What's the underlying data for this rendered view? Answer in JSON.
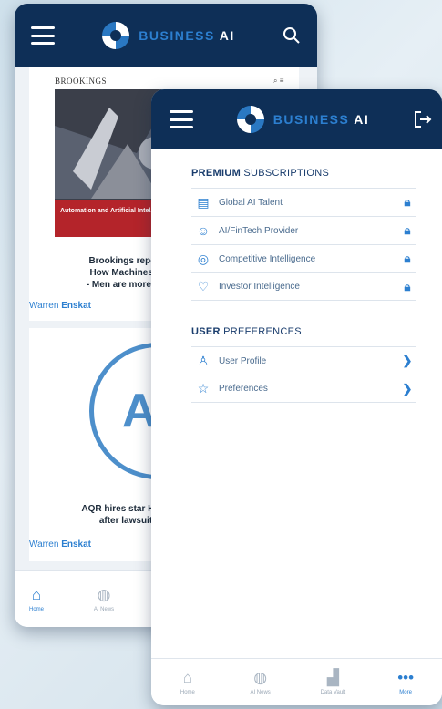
{
  "brand": {
    "part1": "BUSINESS",
    "part2": "AI"
  },
  "back_screen": {
    "article1": {
      "source": "BROOKINGS",
      "image_caption": "Automation and Artificial Intel...",
      "headline_lines": [
        "Brookings report",
        "How Machines A",
        "- Men are more Vu"
      ],
      "author_first": "Warren",
      "author_last": "Enskat"
    },
    "article2": {
      "logo_text": "AQ",
      "headline_lines": [
        "AQR hires star Head",
        "after lawsuit"
      ],
      "author_first": "Warren",
      "author_last": "Enskat"
    },
    "tabs": [
      {
        "label": "Home",
        "icon": "home-icon"
      },
      {
        "label": "AI News",
        "icon": "globe-icon"
      }
    ]
  },
  "menu": {
    "premium": {
      "title_bold": "PREMIUM",
      "title_rest": " SUBSCRIPTIONS",
      "items": [
        {
          "label": "Global AI Talent",
          "icon": "talent-icon"
        },
        {
          "label": "AI/FinTech Provider",
          "icon": "provider-icon"
        },
        {
          "label": "Competitive Intelligence",
          "icon": "target-icon"
        },
        {
          "label": "Investor Intelligence",
          "icon": "handshake-icon"
        }
      ]
    },
    "prefs": {
      "title_bold": "USER",
      "title_rest": " PREFERENCES",
      "items": [
        {
          "label": "User Profile",
          "icon": "user-icon"
        },
        {
          "label": "Preferences",
          "icon": "star-icon"
        }
      ]
    },
    "tabs": [
      {
        "label": "Home",
        "icon": "home-icon"
      },
      {
        "label": "AI News",
        "icon": "globe-icon"
      },
      {
        "label": "Data Vault",
        "icon": "chart-icon"
      },
      {
        "label": "More",
        "icon": "more-icon"
      }
    ]
  },
  "colors": {
    "header": "#0e2f57",
    "accent": "#2c7fd0"
  }
}
